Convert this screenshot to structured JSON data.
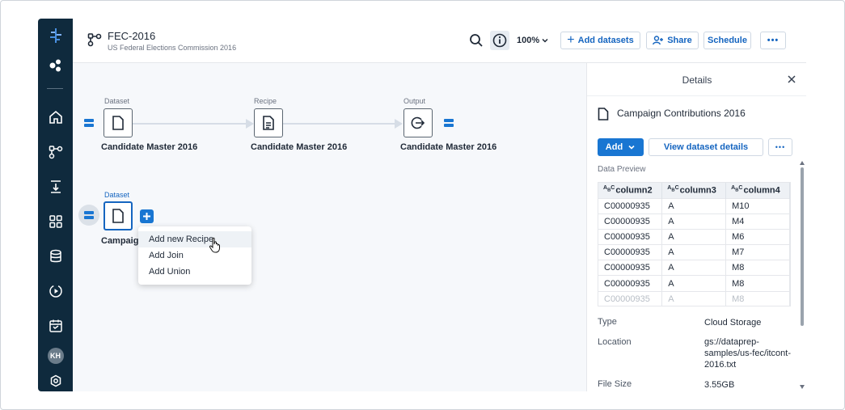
{
  "header": {
    "title": "FEC-2016",
    "subtitle": "US Federal Elections Commission 2016",
    "zoom": "100%",
    "add_datasets": "Add datasets",
    "share": "Share",
    "schedule": "Schedule"
  },
  "sidebar": {
    "avatar_initials": "KH",
    "icons": [
      "dataprep-logo-icon",
      "apps-icon",
      "home-icon",
      "flow-icon",
      "job-icon",
      "grid-icon",
      "database-icon",
      "play-circle-icon",
      "calendar-icon",
      "settings-icon"
    ]
  },
  "flow": {
    "nodes": [
      {
        "type_label": "Dataset",
        "name": "Candidate Master 2016"
      },
      {
        "type_label": "Recipe",
        "name": "Candidate Master 2016"
      },
      {
        "type_label": "Output",
        "name": "Candidate Master 2016"
      },
      {
        "type_label": "Dataset",
        "name": "Campaign"
      }
    ]
  },
  "context_menu": {
    "items": [
      "Add new Recipe",
      "Add Join",
      "Add Union"
    ]
  },
  "details": {
    "title": "Details",
    "dataset_name": "Campaign Contributions 2016",
    "add_label": "Add",
    "view_details_label": "View dataset details",
    "data_preview_label": "Data Preview",
    "preview": {
      "columns": [
        "column2",
        "column3",
        "column4"
      ],
      "rows": [
        [
          "C00000935",
          "A",
          "M10"
        ],
        [
          "C00000935",
          "A",
          "M4"
        ],
        [
          "C00000935",
          "A",
          "M6"
        ],
        [
          "C00000935",
          "A",
          "M7"
        ],
        [
          "C00000935",
          "A",
          "M8"
        ],
        [
          "C00000935",
          "A",
          "M8"
        ],
        [
          "C00000935",
          "A",
          "M8"
        ]
      ]
    },
    "meta": {
      "type_key": "Type",
      "type_value": "Cloud Storage",
      "location_key": "Location",
      "location_value": "gs://dataprep-samples/us-fec/itcont-2016.txt",
      "filesize_key": "File Size",
      "filesize_value": "3.55GB"
    }
  },
  "colors": {
    "sidebar_bg": "#0f2a3d",
    "accent": "#1976d2",
    "canvas_bg": "#f6f8fb"
  }
}
